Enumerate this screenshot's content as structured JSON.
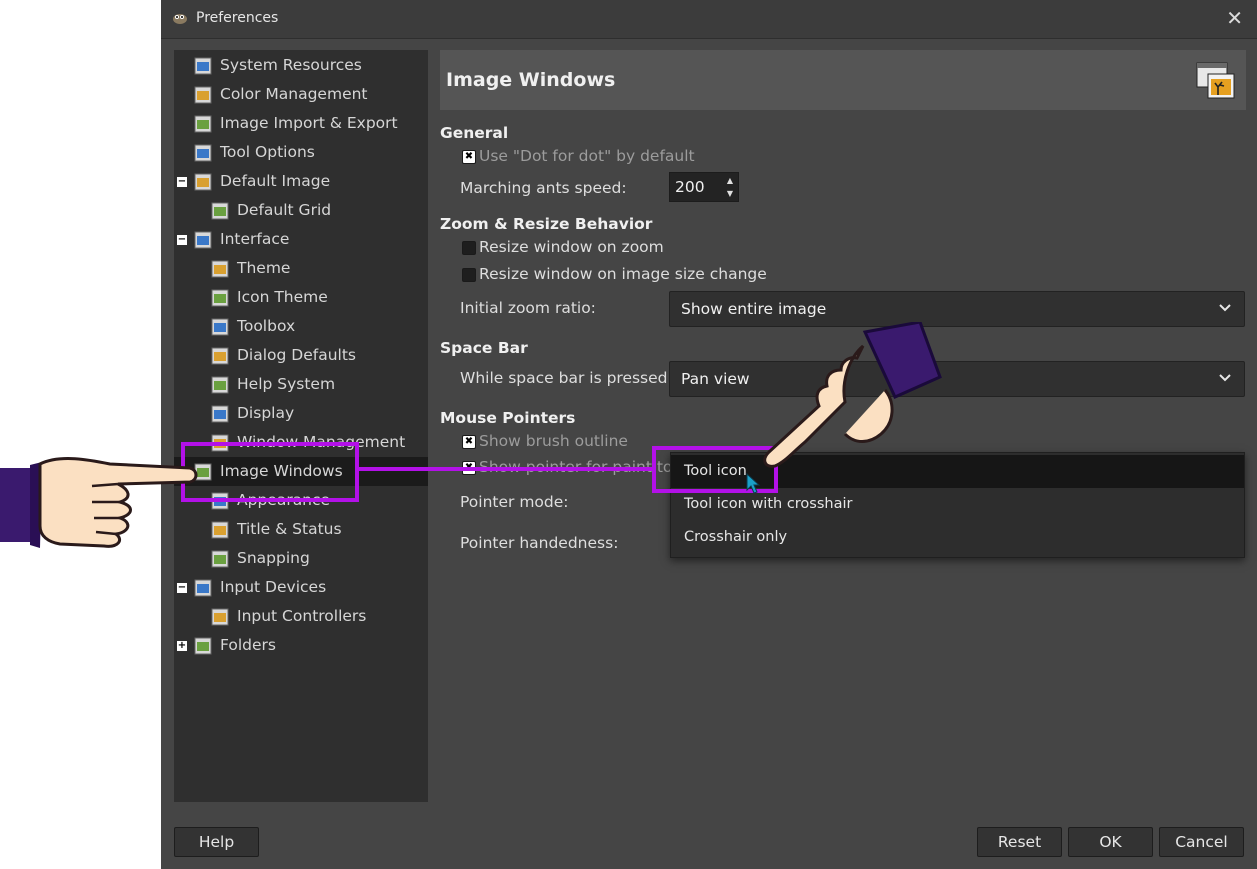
{
  "window": {
    "title": "Preferences",
    "close_glyph": "✕"
  },
  "tree": {
    "items": [
      {
        "label": "System Resources",
        "icon": "memory-chip-icon",
        "level": 0
      },
      {
        "label": "Color Management",
        "icon": "color-triangle-icon",
        "level": 0
      },
      {
        "label": "Image Import & Export",
        "icon": "import-export-icon",
        "level": 0
      },
      {
        "label": "Tool Options",
        "icon": "tool-options-icon",
        "level": 0
      },
      {
        "label": "Default Image",
        "icon": "default-image-icon",
        "level": 0,
        "expander": "−"
      },
      {
        "label": "Default Grid",
        "icon": "grid-icon",
        "level": 1
      },
      {
        "label": "Interface",
        "icon": "interface-icon",
        "level": 0,
        "expander": "−"
      },
      {
        "label": "Theme",
        "icon": "theme-icon",
        "level": 1
      },
      {
        "label": "Icon Theme",
        "icon": "icon-theme-icon",
        "level": 1
      },
      {
        "label": "Toolbox",
        "icon": "toolbox-icon",
        "level": 1
      },
      {
        "label": "Dialog Defaults",
        "icon": "dialog-defaults-icon",
        "level": 1
      },
      {
        "label": "Help System",
        "icon": "lifebuoy-icon",
        "level": 1
      },
      {
        "label": "Display",
        "icon": "display-icon",
        "level": 1
      },
      {
        "label": "Window Management",
        "icon": "window-management-icon",
        "level": 1
      },
      {
        "label": "Image Windows",
        "icon": "image-windows-icon",
        "level": 0,
        "selected": true
      },
      {
        "label": "Appearance",
        "icon": "appearance-icon",
        "level": 1
      },
      {
        "label": "Title & Status",
        "icon": "title-status-icon",
        "level": 1
      },
      {
        "label": "Snapping",
        "icon": "snapping-icon",
        "level": 1
      },
      {
        "label": "Input Devices",
        "icon": "input-devices-icon",
        "level": 0,
        "expander": "−"
      },
      {
        "label": "Input Controllers",
        "icon": "input-controllers-icon",
        "level": 1
      },
      {
        "label": "Folders",
        "icon": "folder-icon",
        "level": 0,
        "expander": "+"
      }
    ]
  },
  "header": {
    "title": "Image Windows",
    "icon": "image-windows-icon"
  },
  "general": {
    "heading": "General",
    "dot_for_dot": "Use \"Dot for dot\" by default",
    "marching_label": "Marching ants speed:",
    "marching_value": "200"
  },
  "zoom": {
    "heading": "Zoom & Resize Behavior",
    "resize_on_zoom": "Resize window on zoom",
    "resize_on_size": "Resize window on image size change",
    "initial_label": "Initial zoom ratio:",
    "initial_value": "Show entire image"
  },
  "space": {
    "heading": "Space Bar",
    "label": "While space bar is pressed:",
    "value": "Pan view"
  },
  "mouse": {
    "heading": "Mouse Pointers",
    "brush_outline": "Show brush outline",
    "pointer_paint": "Show pointer for paint tools",
    "mode_label": "Pointer mode:",
    "hand_label": "Pointer handedness:"
  },
  "popup": {
    "options": [
      "Tool icon",
      "Tool icon with crosshair",
      "Crosshair only"
    ],
    "selected": 0
  },
  "buttons": {
    "help": "Help",
    "reset": "Reset",
    "ok": "OK",
    "cancel": "Cancel"
  },
  "colors": {
    "highlight": "#b311e8",
    "window_bg": "#454545",
    "tree_bg": "#2f2f2f"
  }
}
